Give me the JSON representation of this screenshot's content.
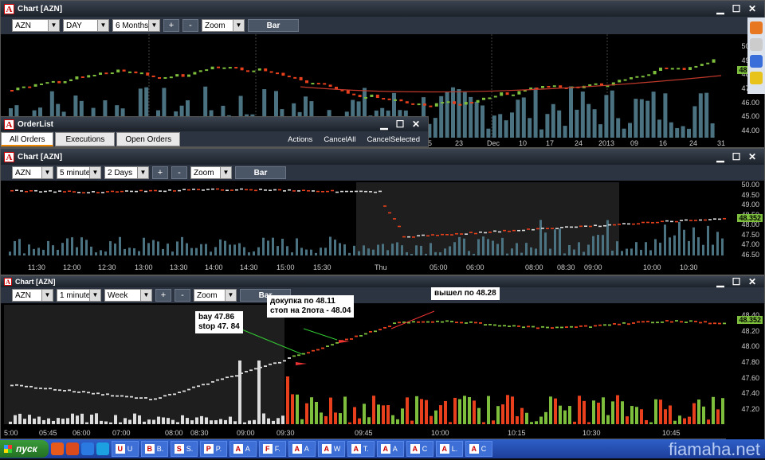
{
  "chart1": {
    "title": "Chart [AZN]",
    "symbol": "AZN",
    "interval": "DAY",
    "range": "6 Months",
    "zoom": "Zoom",
    "bar_btn": "Bar",
    "plus": "+",
    "minus": "-",
    "y_labels": [
      "50.00",
      "49.00",
      "48.00",
      "47.00",
      "46.00",
      "45.00",
      "44.00"
    ],
    "price_tag": "48.352",
    "x_labels": [
      "5",
      "23",
      "Dec",
      "10",
      "17",
      "24",
      "2013",
      "09",
      "16",
      "24",
      "31"
    ]
  },
  "orderlist": {
    "title": "OrderList",
    "tabs": [
      "All Orders",
      "Executions",
      "Open Orders"
    ],
    "actions": [
      "Actions",
      "CancelAll",
      "CancelSelected"
    ]
  },
  "chart2": {
    "title": "Chart [AZN]",
    "symbol": "AZN",
    "interval": "5 minutes",
    "range": "2 Days",
    "zoom": "Zoom",
    "bar_btn": "Bar",
    "plus": "+",
    "minus": "-",
    "y_labels": [
      "50.00",
      "49.50",
      "49.00",
      "48.50",
      "48.00",
      "47.50",
      "47.00",
      "46.50"
    ],
    "price_tag": "48.352",
    "x_labels": [
      "11:30",
      "12:00",
      "12:30",
      "13:00",
      "13:30",
      "14:00",
      "14:30",
      "15:00",
      "15:30",
      "Thu",
      "05:00",
      "06:00",
      "08:00",
      "08:30",
      "09:00",
      "10:00",
      "10:30"
    ]
  },
  "chart3": {
    "title": "Chart [AZN]",
    "symbol": "AZN",
    "interval": "1 minute",
    "range": "Week",
    "zoom": "Zoom",
    "bar_btn": "Bar",
    "plus": "+",
    "minus": "-",
    "y_labels": [
      "48.40",
      "48.20",
      "48.00",
      "47.80",
      "47.60",
      "47.40",
      "47.20"
    ],
    "price_tag": "48.352",
    "x_labels": [
      "5:00",
      "05:45",
      "06:00",
      "07:00",
      "08:00",
      "08:30",
      "09:00",
      "09:30",
      "09:45",
      "10:00",
      "10:15",
      "10:30",
      "10:45"
    ],
    "annotations": {
      "buy": "bay 47.86\nstop 47. 84",
      "add": "докупка по 48.11\nстоп на 2пота - 48.04",
      "exit": "вышел по 48.28"
    }
  },
  "taskbar": {
    "start": "пуск",
    "tasks": [
      {
        "icon": "U",
        "label": "U"
      },
      {
        "icon": "B",
        "label": "B."
      },
      {
        "icon": "S",
        "label": "S."
      },
      {
        "icon": "P",
        "label": "P."
      },
      {
        "icon": "A",
        "label": "A"
      },
      {
        "icon": "F",
        "label": "F."
      },
      {
        "icon": "A",
        "label": "A"
      },
      {
        "icon": "A",
        "label": "W"
      },
      {
        "icon": "A",
        "label": "T."
      },
      {
        "icon": "A",
        "label": "A"
      },
      {
        "icon": "A",
        "label": "C"
      },
      {
        "icon": "A",
        "label": "L."
      },
      {
        "icon": "A",
        "label": "C"
      }
    ],
    "watermark": "fiamaha.net"
  },
  "colors": {
    "up": "#7dbf3c",
    "down": "#e8401c",
    "volume": "#4a7280",
    "ma": "#c0392b"
  }
}
